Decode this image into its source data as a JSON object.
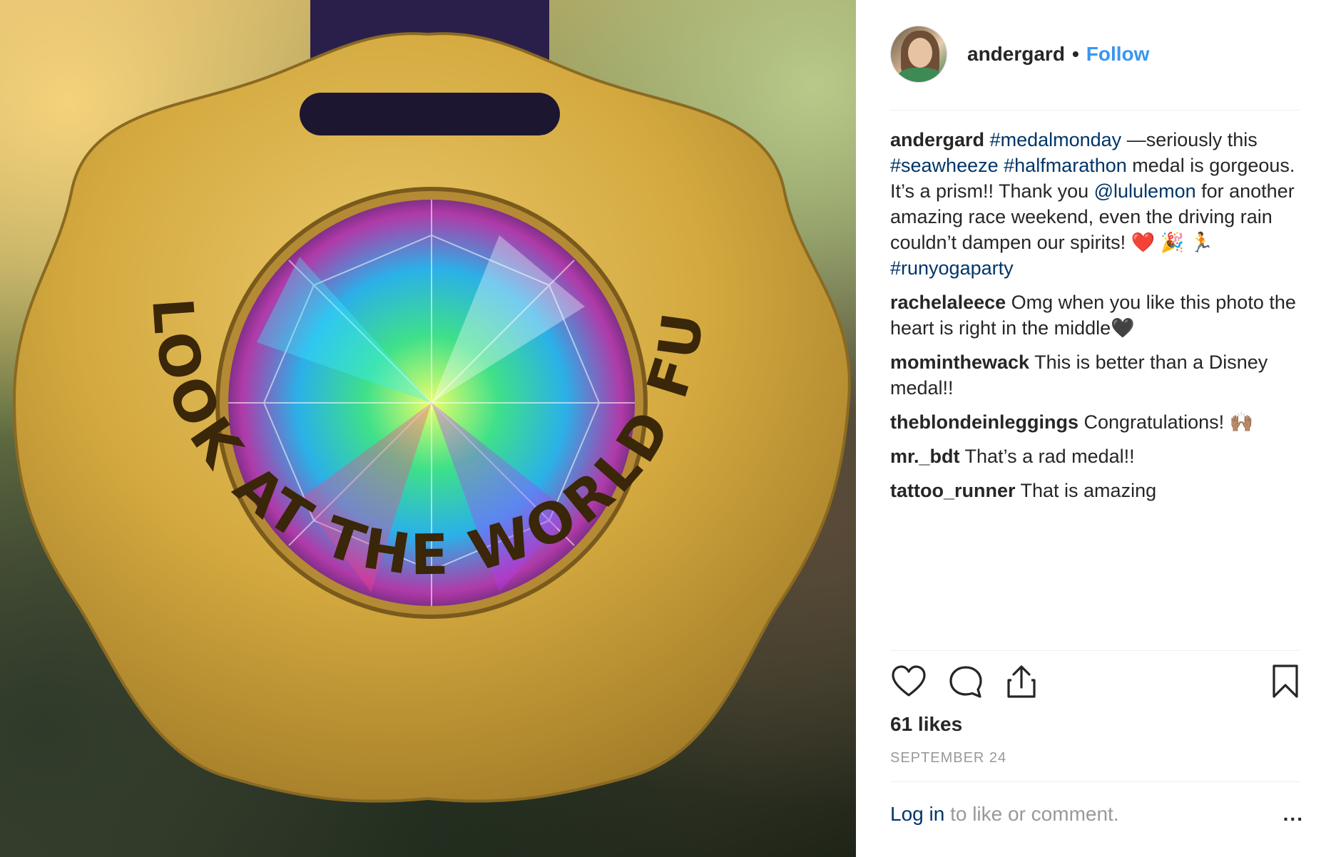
{
  "post": {
    "photo_text": "LOOK AT THE WORLD FUNFILTERED"
  },
  "header": {
    "username": "andergard",
    "separator": "•",
    "follow_label": "Follow"
  },
  "caption": {
    "username": "andergard",
    "tag1": "#medalmonday",
    "text1": " —seriously this ",
    "tag2": "#seawheeze",
    "space1": " ",
    "tag3": "#halfmarathon",
    "text2": " medal is gorgeous. It’s a prism!! Thank you ",
    "mention": "@lululemon",
    "text3": " for another amazing race weekend, even the driving rain couldn’t dampen our spirits! ❤️ 🎉 🏃 ",
    "tag4": "#runyogaparty"
  },
  "comments": [
    {
      "username": "rachelaleece",
      "text": " Omg when you like this photo the heart is right in the middle🖤"
    },
    {
      "username": "mominthewack",
      "text": " This is better than a Disney medal!!"
    },
    {
      "username": "theblondeinleggings",
      "text": " Congratulations! 🙌🏽"
    },
    {
      "username": "mr._bdt",
      "text": " That’s a rad medal!!"
    },
    {
      "username": "tattoo_runner",
      "text": " That is amazing"
    }
  ],
  "stats": {
    "likes": "61 likes",
    "date": "SEPTEMBER 24"
  },
  "footer": {
    "login_label": "Log in",
    "prompt": " to like or comment.",
    "more_label": "..."
  },
  "icons": {
    "like": "heart-icon",
    "comment": "comment-icon",
    "share": "share-icon",
    "save": "bookmark-icon",
    "more": "more-options-icon"
  },
  "colors": {
    "link_blue": "#003569",
    "follow_blue": "#3897f0",
    "muted": "#999999",
    "text": "#262626"
  }
}
